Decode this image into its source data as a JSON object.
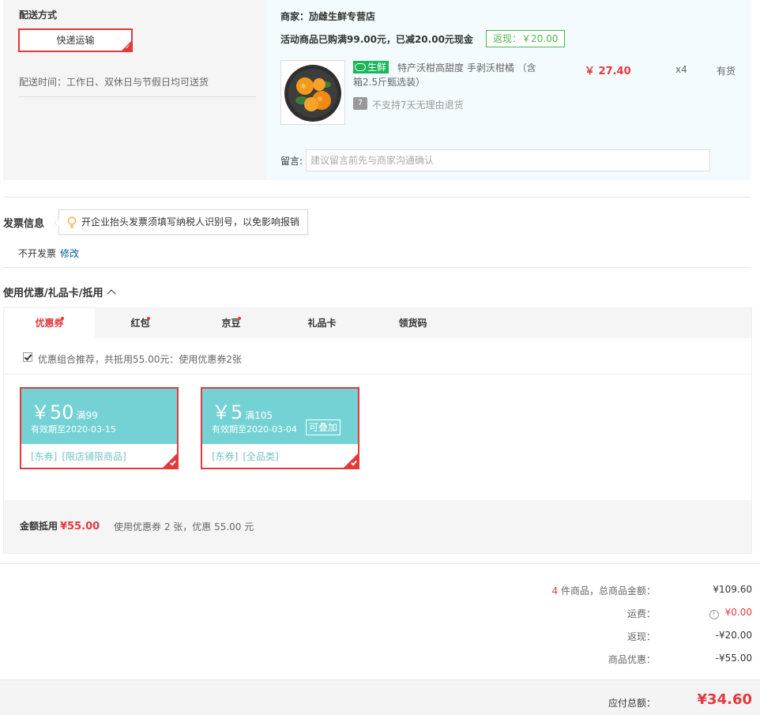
{
  "delivery": {
    "title": "配送方式",
    "option": "快递运输",
    "time": "配送时间：工作日、双休日与节假日均可送货"
  },
  "shop": {
    "name": "商家：劢雌生鲜专营店",
    "promo": "活动商品已购满99.00元，已减20.00元现金",
    "rebate": "返现：￥20.00",
    "product": {
      "tag": "生鲜",
      "name": "特产沃柑高甜度 手剥沃柑橘 （含箱2.5斤甄选装）",
      "price": "￥ 27.40",
      "qty": "x4",
      "stock": "有货",
      "return_icon": "7",
      "return_policy": "不支持7天无理由退货"
    },
    "remark_label": "留言:",
    "remark_placeholder": "建议留言前先与商家沟通确认"
  },
  "invoice": {
    "title": "发票信息",
    "tip": "开企业抬头发票须填写纳税人识别号，以免影响报销",
    "status": "不开发票",
    "edit": "修改"
  },
  "coupons": {
    "title": "使用优惠/礼品卡/抵用",
    "tabs": [
      {
        "label": "优惠券",
        "dot": true
      },
      {
        "label": "红包",
        "dot": true
      },
      {
        "label": "京豆",
        "dot": true
      },
      {
        "label": "礼品卡",
        "dot": false
      },
      {
        "label": "领货码",
        "dot": false
      }
    ],
    "combo": "优惠组合推荐，共抵用55.00元：使用优惠券2张",
    "items": [
      {
        "amount": "￥50",
        "condition": "满99",
        "expiry": "有效期至2020-03-15",
        "badge": "",
        "scope": [
          "[东券]",
          "[限店铺限商品]"
        ]
      },
      {
        "amount": "￥5",
        "condition": "满105",
        "expiry": "有效期至2020-03-04",
        "badge": "可叠加",
        "scope": [
          "[东券]",
          "[全品类]"
        ]
      }
    ],
    "deduct_label": "金额抵用",
    "deduct_amount": "¥55.00",
    "deduct_desc": "使用优惠券 2 张，优惠 55.00 元"
  },
  "summary": {
    "count": "4",
    "count_suffix": " 件商品，总商品金额：",
    "total": "¥109.60",
    "shipping_label": "运费：",
    "shipping": "¥0.00",
    "rebate_label": "返现：",
    "rebate": "-¥20.00",
    "discount_label": "商品优惠：",
    "discount": "-¥55.00",
    "pay_label": "应付总额：",
    "pay": "¥34.60"
  },
  "colors": {
    "accent": "#e4393c",
    "coupon": "#74d2d4",
    "fresh": "#1bb65a"
  }
}
